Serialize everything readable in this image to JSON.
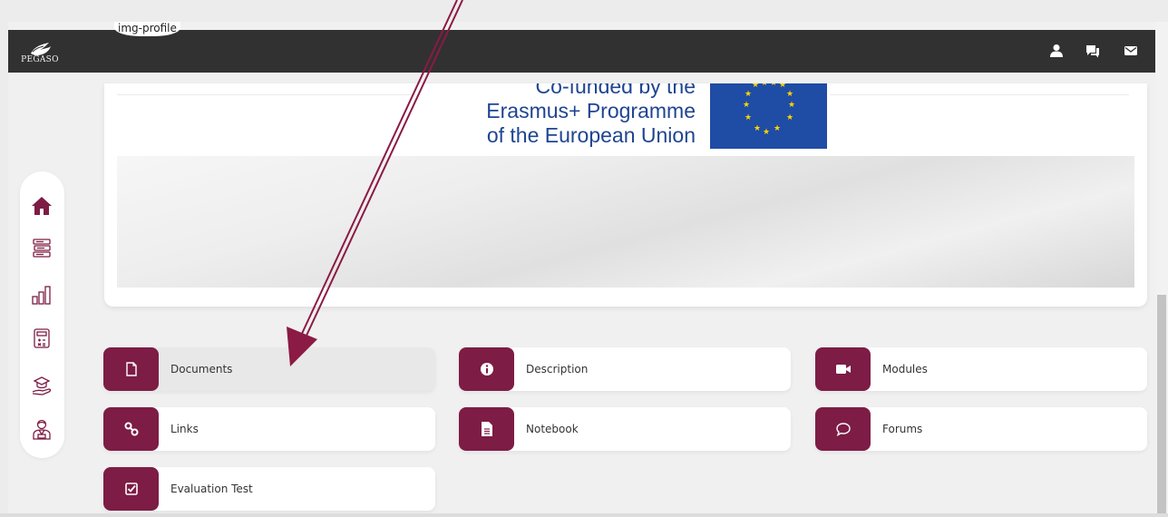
{
  "topbar": {
    "logo_text": "PEGASO",
    "profile_alt": "img-profile",
    "icons": [
      "user-icon",
      "chat-icon",
      "mail-icon"
    ]
  },
  "banner": {
    "eu_lines": [
      "Co-funded by the",
      "Erasmus+ Programme",
      "of the European Union"
    ]
  },
  "sidebar": {
    "items": [
      "home-icon",
      "books-icon",
      "chart-icon",
      "calculator-icon",
      "graduation-hand-icon",
      "teacher-icon"
    ]
  },
  "menu": {
    "documents": "Documents",
    "description": "Description",
    "modules": "Modules",
    "links": "Links",
    "notebook": "Notebook",
    "forums": "Forums",
    "evaluation_test": "Evaluation Test"
  },
  "colors": {
    "accent": "#7d1c45",
    "topbar": "#313131",
    "eu_blue": "#1f4ca5",
    "eu_text": "#1f4591",
    "arrow": "#8b1a44"
  }
}
